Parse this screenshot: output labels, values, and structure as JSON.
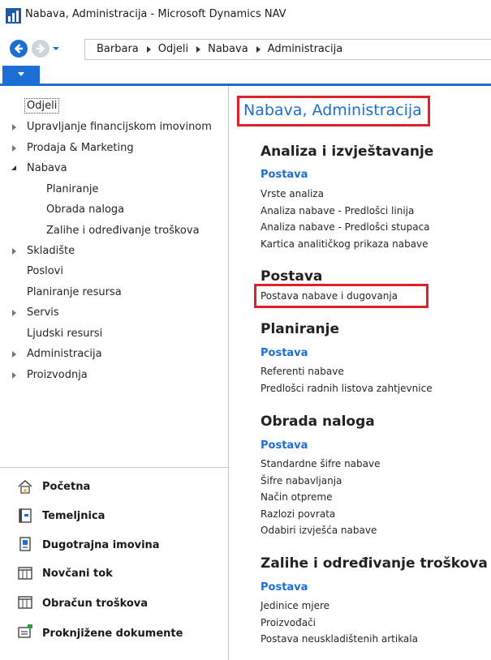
{
  "window": {
    "title": "Nabava, Administracija - Microsoft Dynamics NAV"
  },
  "breadcrumb": [
    "Barbara",
    "Odjeli",
    "Nabava",
    "Administracija"
  ],
  "navpane": {
    "tree": [
      {
        "label": "Odjeli",
        "selected": true
      },
      {
        "label": "Upravljanje financijskom imovinom",
        "expandable": true
      },
      {
        "label": "Prodaja & Marketing",
        "expandable": true
      },
      {
        "label": "Nabava",
        "expanded": true
      },
      {
        "label": "Planiranje",
        "child": true
      },
      {
        "label": "Obrada naloga",
        "child": true
      },
      {
        "label": "Zalihe i određivanje troškova",
        "child": true
      },
      {
        "label": "Skladište",
        "expandable": true
      },
      {
        "label": "Poslovi"
      },
      {
        "label": "Planiranje resursa"
      },
      {
        "label": "Servis",
        "expandable": true
      },
      {
        "label": "Ljudski resursi"
      },
      {
        "label": "Administracija",
        "expandable": true
      },
      {
        "label": "Proizvodnja",
        "expandable": true
      }
    ],
    "areas": [
      {
        "label": "Početna",
        "icon": "home-icon"
      },
      {
        "label": "Temeljnica",
        "icon": "journal-icon"
      },
      {
        "label": "Dugotrajna imovina",
        "icon": "fixed-assets-icon"
      },
      {
        "label": "Novčani tok",
        "icon": "cash-flow-icon"
      },
      {
        "label": "Obračun troškova",
        "icon": "cost-accounting-icon"
      },
      {
        "label": "Proknjižene dokumente",
        "icon": "posted-documents-icon"
      }
    ]
  },
  "content": {
    "page_title": "Nabava, Administracija",
    "sections": [
      {
        "heading": "Analiza i izvještavanje",
        "subheading": "Postava",
        "links": [
          "Vrste analiza",
          "Analiza nabave - Predlošci linija",
          "Analiza nabave - Predlošci stupaca",
          "Kartica analitičkog prikaza nabave"
        ]
      },
      {
        "heading": "Postava",
        "subheading": "",
        "links": [
          "Postava nabave i dugovanja"
        ]
      },
      {
        "heading": "Planiranje",
        "subheading": "Postava",
        "links": [
          "Referenti nabave",
          "Predlošci radnih listova zahtjevnice"
        ]
      },
      {
        "heading": "Obrada naloga",
        "subheading": "Postava",
        "links": [
          "Standardne šifre nabave",
          "Šifre nabavljanja",
          "Način otpreme",
          "Razlozi povrata",
          "Odabiri izvješća nabave"
        ]
      },
      {
        "heading": "Zalihe i određivanje troškova",
        "subheading": "Postava",
        "links": [
          "Jedinice mjere",
          "Proizvođači",
          "Postava neuskladištenih artikala"
        ]
      }
    ]
  },
  "colors": {
    "accent": "#1c6ed4",
    "highlight": "#e0202a"
  }
}
